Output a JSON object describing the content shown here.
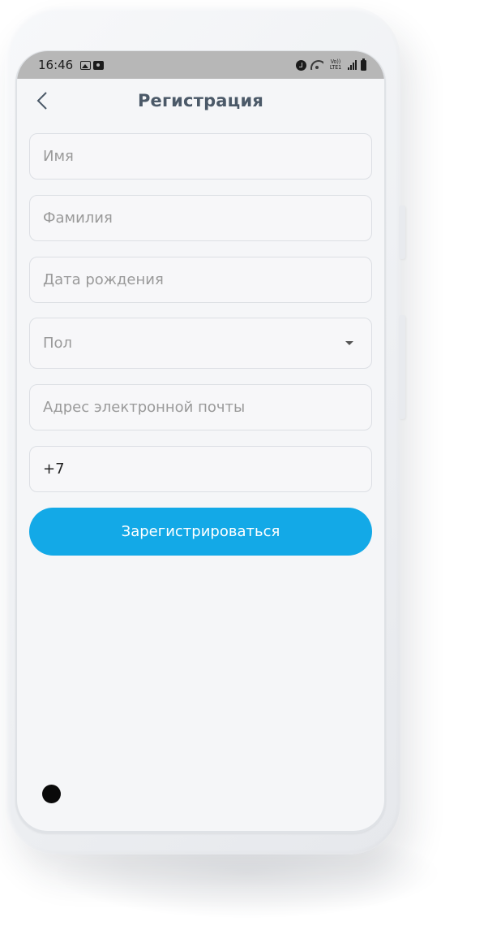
{
  "status_bar": {
    "time": "16:46",
    "volte_top": "Vo))",
    "volte_bottom": "LTE1",
    "icons": [
      "image-icon",
      "screen-record-icon",
      "alarm-icon",
      "wifi-icon",
      "volte-icon",
      "signal-icon",
      "battery-icon"
    ]
  },
  "header": {
    "title": "Регистрация",
    "back_icon": "chevron-left-icon"
  },
  "form": {
    "first_name": {
      "placeholder": "Имя",
      "value": ""
    },
    "last_name": {
      "placeholder": "Фамилия",
      "value": ""
    },
    "birth_date": {
      "placeholder": "Дата рождения",
      "value": ""
    },
    "gender": {
      "placeholder": "Пол",
      "icon": "dropdown-arrow-icon"
    },
    "email": {
      "placeholder": "Адрес электронной почты",
      "value": ""
    },
    "phone": {
      "value": "+7"
    }
  },
  "submit": {
    "label": "Зарегистрироваться"
  },
  "colors": {
    "primary": "#13a9e7",
    "title": "#4b5968",
    "status_bar": "#b7b7b7",
    "screen_bg": "#f5f6f8",
    "placeholder": "#9a9a9a"
  }
}
